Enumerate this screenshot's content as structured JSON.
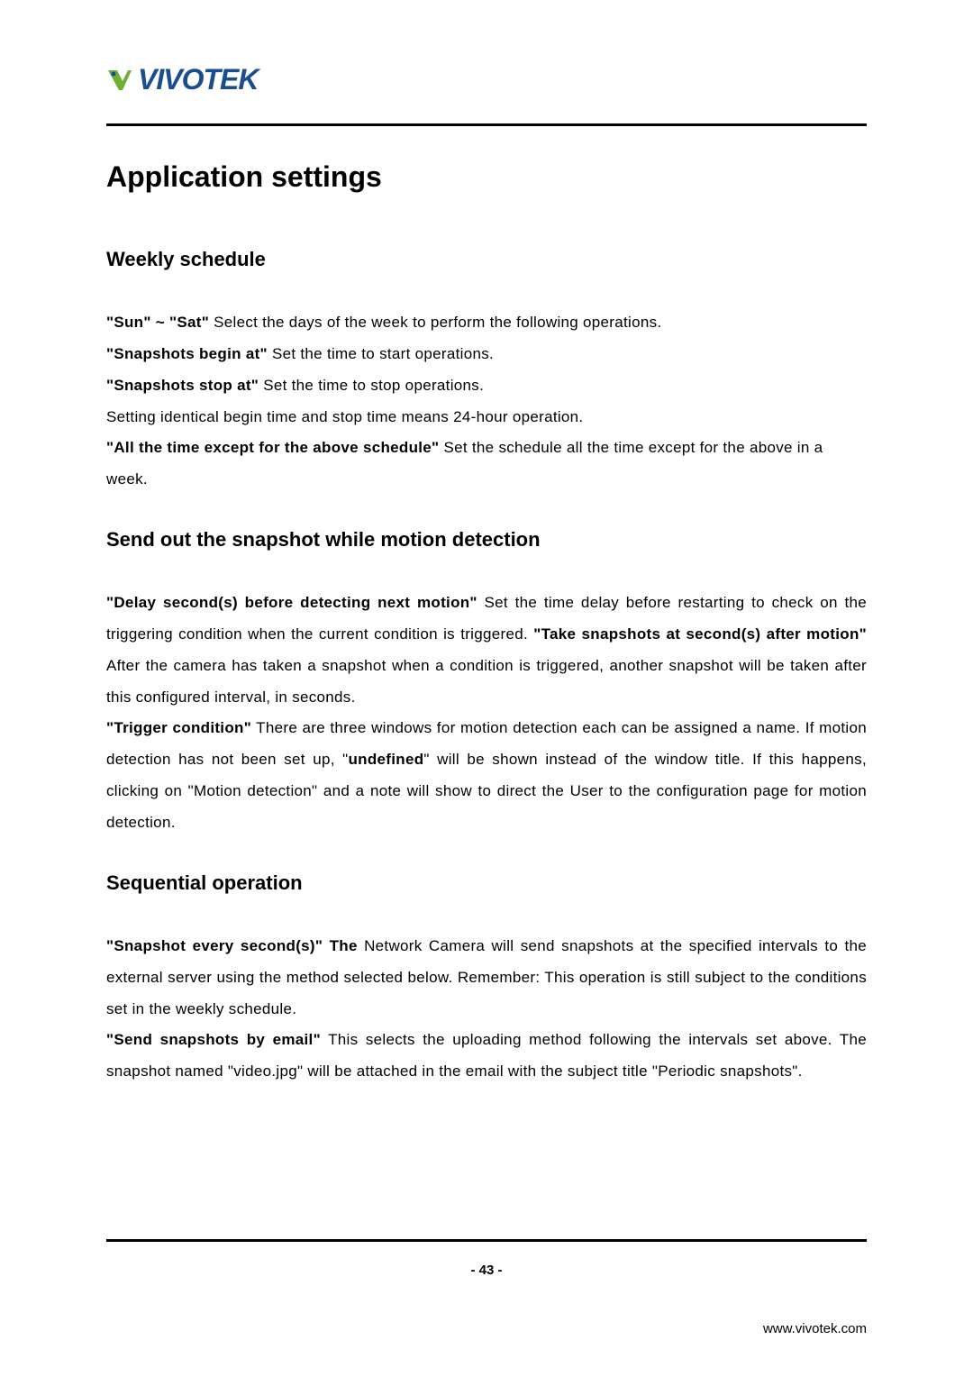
{
  "brand": {
    "name": "VIVOTEK"
  },
  "title": "Application settings",
  "sections": {
    "weekly": {
      "heading": "Weekly schedule",
      "items": {
        "sun_sat_label": "\"Sun\" ~ \"Sat\"",
        "sun_sat_text": " Select the days of the week to perform the following operations.",
        "begin_label": "\"Snapshots begin at\"",
        "begin_text": " Set the time to start operations.",
        "stop_label": "\"Snapshots stop at\"",
        "stop_text": " Set the time to stop operations.",
        "identical_text": "Setting identical begin time and stop time means 24-hour operation.",
        "except_label": "\"All the time except for the above schedule\"",
        "except_text": " Set the schedule all the time except for the above in a week."
      }
    },
    "motion": {
      "heading": "Send out the snapshot while motion detection",
      "items": {
        "delay_label": "\"Delay second(s) before detecting next motion\"",
        "delay_text": " Set the time delay before restarting to check on the triggering condition when the current condition is triggered.",
        "take_label": "\"Take snapshots at second(s) after motion\"",
        "take_text": " After the camera has taken a snapshot when a condition is triggered, another snapshot will be taken after this configured interval, in seconds.",
        "trigger_label": "\"Trigger condition\"",
        "trigger_text_1": " There are three windows for motion detection each can be assigned a name. If motion detection has not been set up, \"",
        "trigger_undefined": "undefined",
        "trigger_text_2": "\" will be shown instead of the window title. If this happens, clicking on \"Motion detection\" and a note will show to direct the User to the configuration page for motion detection."
      }
    },
    "sequential": {
      "heading": "Sequential operation",
      "items": {
        "every_label": "\"Snapshot every second(s)\" The",
        "every_text": " Network Camera will send snapshots at the specified intervals to the external server using the method selected below. Remember: This operation is still subject to the conditions set in the weekly schedule.",
        "email_label": "\"Send snapshots by email\"",
        "email_text": " This selects the uploading method following the intervals set above. The snapshot named \"video.jpg\" will be attached in the email with the subject title \"Periodic snapshots\"."
      }
    }
  },
  "footer": {
    "page_number": "- 43 -",
    "url": "www.vivotek.com"
  }
}
